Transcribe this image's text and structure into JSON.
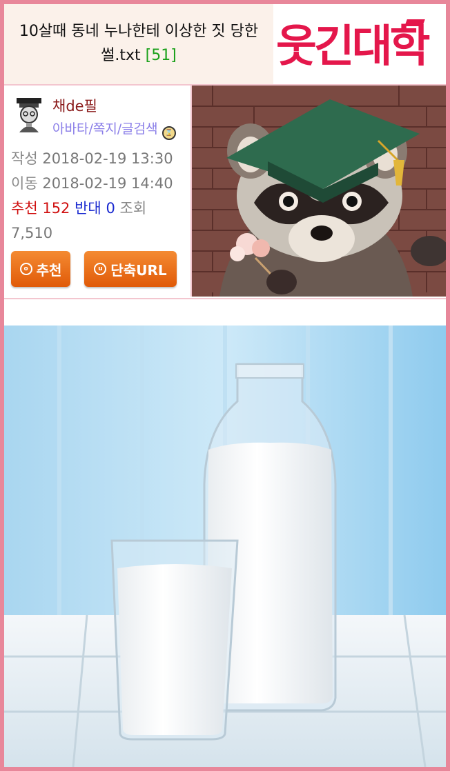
{
  "post": {
    "title_main": "10살때 동네 누나한테 이상한 짓 당한 썰.txt",
    "comment_count": "[51]"
  },
  "site": {
    "logo_text": "웃긴대학",
    "accent_color": "#e4174b"
  },
  "author": {
    "name": "채de필",
    "links": "아바타/쪽지/글검색",
    "avatar_icon": "student-avatar-icon",
    "level_icon": "level-badge-icon"
  },
  "meta": {
    "written_label": "작성",
    "written_value": "2018-02-19 13:30",
    "moved_label": "이동",
    "moved_value": "2018-02-19 14:40",
    "recommend_label": "추천",
    "recommend_value": "152",
    "oppose_label": "반대",
    "oppose_value": "0",
    "views_label": "조회",
    "views_value": "7,510"
  },
  "buttons": {
    "recommend_label": "추천",
    "short_url_label": "단축URL",
    "recommend_icon": "circle-o-icon",
    "short_url_icon": "circle-u-icon",
    "button_color": "#f07020"
  },
  "images": {
    "banner": "raccoon-graduate-illustration",
    "content": "milk-bottle-and-glass-photo"
  }
}
